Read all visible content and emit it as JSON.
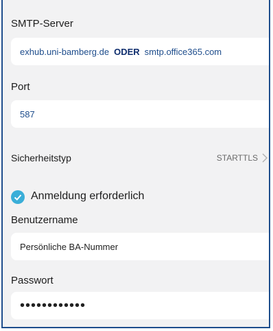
{
  "smtp": {
    "label": "SMTP-Server",
    "value_part1": "exhub.uni-bamberg.de",
    "value_or": "ODER",
    "value_part2": "smtp.office365.com"
  },
  "port": {
    "label": "Port",
    "value": "587"
  },
  "security": {
    "label": "Sicherheitstyp",
    "value": "STARTTLS",
    "chevron_icon": "chevron-right-icon"
  },
  "login": {
    "label": "Anmeldung erforderlich",
    "checked": true,
    "check_icon": "check-icon",
    "accent_color": "#3aaed8"
  },
  "username": {
    "label": "Benutzername",
    "value": "Persönliche BA-Nummer"
  },
  "password": {
    "label": "Passwort",
    "value": "••••••••••••"
  },
  "colors": {
    "accent": "#1e4d8c",
    "background": "#f2f2f3",
    "field": "#ffffff"
  }
}
